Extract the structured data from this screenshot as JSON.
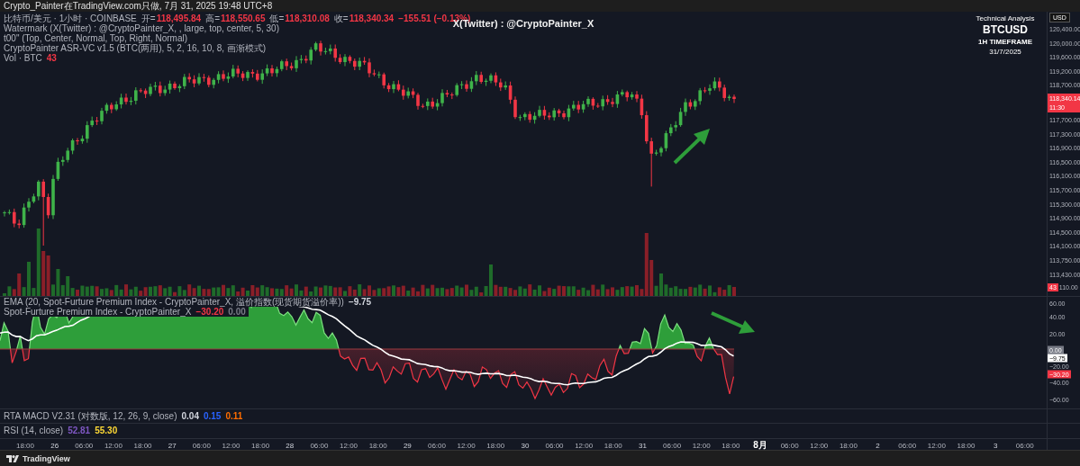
{
  "header": {
    "text": "Crypto_Painter在TradingView.com只做, 7月 31, 2025 19:48 UTC+8"
  },
  "main_pane": {
    "watermark": "X(Twitter) : @CryptoPainter_X",
    "info_block": {
      "subtitle": "Technical Analysis",
      "symbol": "BTCUSD",
      "timeframe": "1H TIMEFRAME",
      "date": "31/7/2025"
    },
    "legend": [
      {
        "title": "比特币/美元 · 1小时 · COINBASE",
        "values": [
          {
            "label": "开=",
            "value": "118,495.84",
            "color": "#f23645"
          },
          {
            "label": "高=",
            "value": "118,550.65",
            "color": "#f23645"
          },
          {
            "label": "低=",
            "value": "118,310.08",
            "color": "#f23645"
          },
          {
            "label": "收=",
            "value": "118,340.34",
            "color": "#f23645"
          },
          {
            "value": "−155.51 (−0.13%)",
            "color": "#f23645"
          }
        ]
      },
      {
        "title": "Watermark (X(Twitter) : @CryptoPainter_X, , large, top, center, 5, 30)"
      },
      {
        "title": "t00\" (Top, Center, Normal, Top, Right, Normal)"
      },
      {
        "title": "CryptoPainter ASR-VC v1.5 (BTC(两用), 5, 2, 16, 10, 8, 画渐模式)"
      },
      {
        "title": "Vol · BTC",
        "values": [
          {
            "value": "43",
            "color": "#f23645"
          }
        ]
      }
    ],
    "axis": {
      "currency": "USD",
      "ticks": [
        {
          "kind": "tick",
          "text": "120,400.00"
        },
        {
          "kind": "tick",
          "text": "120,000.00"
        },
        {
          "kind": "tick",
          "text": "119,600.00"
        },
        {
          "kind": "tick",
          "text": "119,200.00"
        },
        {
          "kind": "tick",
          "text": "118,700.00"
        },
        {
          "kind": "price",
          "text": "118,340.14",
          "sub": "11:30",
          "color": "#f23645"
        },
        {
          "kind": "tick",
          "text": "117,700.00"
        },
        {
          "kind": "tick",
          "text": "117,300.00"
        },
        {
          "kind": "tick",
          "text": "116,900.00"
        },
        {
          "kind": "tick",
          "text": "116,500.00"
        },
        {
          "kind": "tick",
          "text": "116,100.00"
        },
        {
          "kind": "tick",
          "text": "115,700.00"
        },
        {
          "kind": "tick",
          "text": "115,300.00"
        },
        {
          "kind": "tick",
          "text": "114,900.00"
        },
        {
          "kind": "tick",
          "text": "114,500.00"
        },
        {
          "kind": "tick",
          "text": "114,100.00"
        },
        {
          "kind": "tick",
          "text": "113,750.00"
        },
        {
          "kind": "tick",
          "text": "113,430.00"
        },
        {
          "kind": "badge",
          "text": "43",
          "color": "#f23645",
          "label": "110.00"
        }
      ]
    }
  },
  "indicator_pane": {
    "legend": [
      {
        "title": "EMA (20, Spot-Furture Premium Index - CryptoPainter_X, 溢价指数(现货期货溢价率))",
        "values": [
          {
            "value": "−9.75",
            "color": "#d1d4dc"
          }
        ]
      },
      {
        "title": "Spot-Furture Premium Index - CryptoPainter_X",
        "values": [
          {
            "value": "−30.20",
            "color": "#f23645"
          },
          {
            "value": "0.00",
            "color": "#787b86"
          }
        ]
      }
    ],
    "axis": [
      {
        "kind": "tick",
        "text": "60.00"
      },
      {
        "kind": "tick",
        "text": "40.00"
      },
      {
        "kind": "tick",
        "text": "20.00"
      },
      {
        "kind": "badge",
        "text": "0.00",
        "color": "#787b86"
      },
      {
        "kind": "badge",
        "text": "−9.75",
        "color": "#ffffff"
      },
      {
        "kind": "tick",
        "text": "−20.00"
      },
      {
        "kind": "badge",
        "text": "−30.20",
        "color": "#f23645"
      },
      {
        "kind": "tick",
        "text": "−40.00"
      },
      {
        "kind": "tick",
        "text": "−60.00"
      }
    ]
  },
  "macd_pane": {
    "legend": [
      {
        "title": "RTA MACD V2.31 (对数版, 12, 26, 9, close)",
        "values": [
          {
            "value": "0.04",
            "color": "#d1d4dc"
          },
          {
            "value": "0.15",
            "color": "#2962ff"
          },
          {
            "value": "0.11",
            "color": "#ff6d00"
          }
        ]
      }
    ]
  },
  "rsi_pane": {
    "legend": [
      {
        "title": "RSI (14, close)",
        "values": [
          {
            "value": "52.81",
            "color": "#7e57c2"
          },
          {
            "value": "55.30",
            "color": "#fdd835"
          }
        ]
      }
    ]
  },
  "time_axis": [
    {
      "kind": "time",
      "text": "18:00"
    },
    {
      "kind": "day",
      "text": "26"
    },
    {
      "kind": "time",
      "text": "06:00"
    },
    {
      "kind": "time",
      "text": "12:00"
    },
    {
      "kind": "time",
      "text": "18:00"
    },
    {
      "kind": "day",
      "text": "27"
    },
    {
      "kind": "time",
      "text": "06:00"
    },
    {
      "kind": "time",
      "text": "12:00"
    },
    {
      "kind": "time",
      "text": "18:00"
    },
    {
      "kind": "day",
      "text": "28"
    },
    {
      "kind": "time",
      "text": "06:00"
    },
    {
      "kind": "time",
      "text": "12:00"
    },
    {
      "kind": "time",
      "text": "18:00"
    },
    {
      "kind": "day",
      "text": "29"
    },
    {
      "kind": "time",
      "text": "06:00"
    },
    {
      "kind": "time",
      "text": "12:00"
    },
    {
      "kind": "time",
      "text": "18:00"
    },
    {
      "kind": "day",
      "text": "30"
    },
    {
      "kind": "time",
      "text": "06:00"
    },
    {
      "kind": "time",
      "text": "12:00"
    },
    {
      "kind": "time",
      "text": "18:00"
    },
    {
      "kind": "day",
      "text": "31"
    },
    {
      "kind": "time",
      "text": "06:00"
    },
    {
      "kind": "time",
      "text": "12:00"
    },
    {
      "kind": "time",
      "text": "18:00"
    },
    {
      "kind": "month",
      "text": "8月"
    },
    {
      "kind": "time",
      "text": "06:00"
    },
    {
      "kind": "time",
      "text": "12:00"
    },
    {
      "kind": "time",
      "text": "18:00"
    },
    {
      "kind": "day",
      "text": "2"
    },
    {
      "kind": "time",
      "text": "06:00"
    },
    {
      "kind": "time",
      "text": "12:00"
    },
    {
      "kind": "time",
      "text": "18:00"
    },
    {
      "kind": "day",
      "text": "3"
    },
    {
      "kind": "time",
      "text": "06:00"
    }
  ],
  "footer": {
    "brand": "TradingView"
  }
}
